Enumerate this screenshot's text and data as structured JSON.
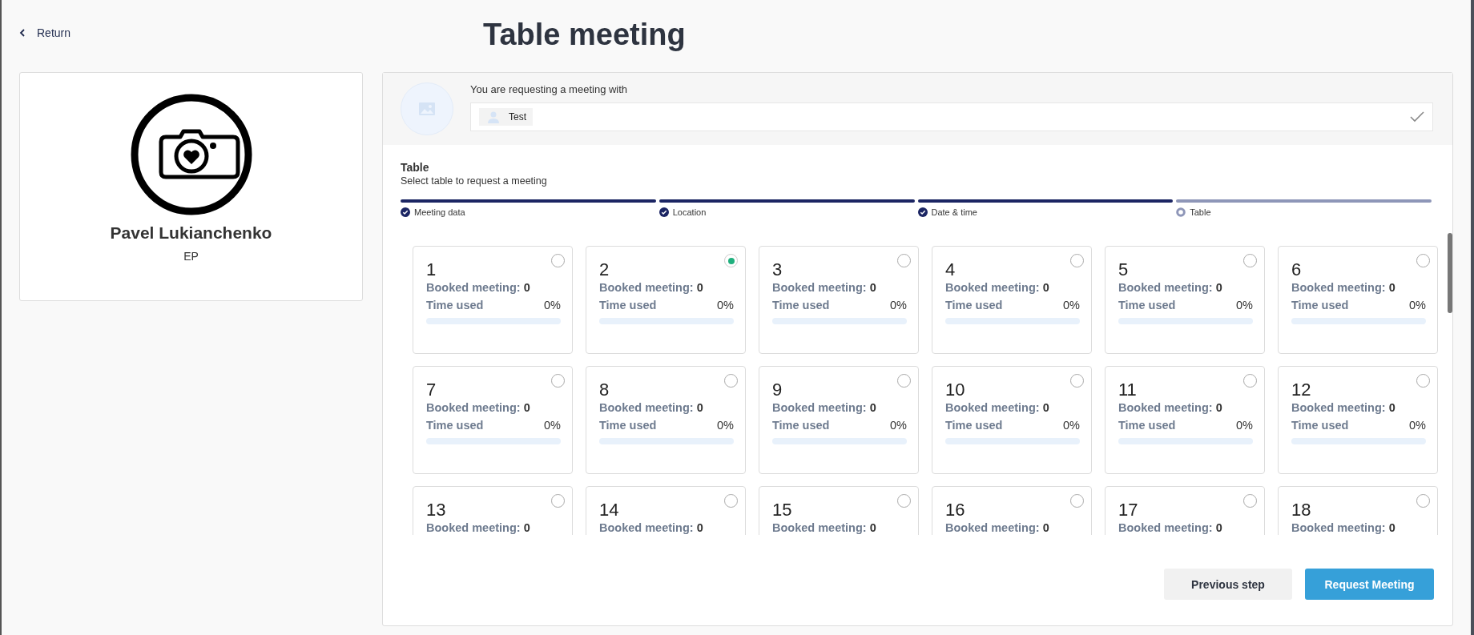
{
  "back_link": {
    "label": "Return"
  },
  "title": "Table meeting",
  "profile": {
    "name": "Pavel Lukianchenko",
    "role": "EP"
  },
  "request": {
    "label": "You are requesting a meeting with",
    "attendee": "Test"
  },
  "section": {
    "title": "Table",
    "subtitle": "Select table to request a meeting"
  },
  "steps": [
    {
      "label": "Meeting data",
      "done": true
    },
    {
      "label": "Location",
      "done": true
    },
    {
      "label": "Date & time",
      "done": true
    },
    {
      "label": "Table",
      "done": false
    }
  ],
  "tables": [
    {
      "number": "1",
      "booked": "Booked meeting: **0**",
      "time_label": "Time used",
      "time_value": "0%",
      "level": 0,
      "selected": false
    },
    {
      "number": "2",
      "booked": "Booked meeting: **0**",
      "time_label": "Time used",
      "time_value": "0%",
      "level": 0,
      "selected": true
    },
    {
      "number": "3",
      "booked": "Booked meeting: **0**",
      "time_label": "Time used",
      "time_value": "0%",
      "level": 0,
      "selected": false
    },
    {
      "number": "4",
      "booked": "Booked meeting: **0**",
      "time_label": "Time used",
      "time_value": "0%",
      "level": 0,
      "selected": false
    },
    {
      "number": "5",
      "booked": "Booked meeting: **0**",
      "time_label": "Time used",
      "time_value": "0%",
      "level": 0,
      "selected": false
    },
    {
      "number": "6",
      "booked": "Booked meeting: **0**",
      "time_label": "Time used",
      "time_value": "0%",
      "level": 0,
      "selected": false
    },
    {
      "number": "7",
      "booked": "Booked meeting: **0**",
      "time_label": "Time used",
      "time_value": "0%",
      "level": 0,
      "selected": false
    },
    {
      "number": "8",
      "booked": "Booked meeting: **0**",
      "time_label": "Time used",
      "time_value": "0%",
      "level": 0,
      "selected": false
    },
    {
      "number": "9",
      "booked": "Booked meeting: **0**",
      "time_label": "Time used",
      "time_value": "0%",
      "level": 0,
      "selected": false
    },
    {
      "number": "10",
      "booked": "Booked meeting: **0**",
      "time_label": "Time used",
      "time_value": "0%",
      "level": 0,
      "selected": false
    },
    {
      "number": "11",
      "booked": "Booked meeting: **0**",
      "time_label": "Time used",
      "time_value": "0%",
      "level": 0,
      "selected": false
    },
    {
      "number": "12",
      "booked": "Booked meeting: **0**",
      "time_label": "Time used",
      "time_value": "0%",
      "level": 0,
      "selected": false
    },
    {
      "number": "13",
      "booked": "Booked meeting: **0**",
      "selected": false
    },
    {
      "number": "14",
      "booked": "Booked meeting: **0**",
      "selected": false
    },
    {
      "number": "15",
      "booked": "Booked meeting: **0**",
      "selected": false
    },
    {
      "number": "16",
      "booked": "Booked meeting: **0**",
      "selected": false
    },
    {
      "number": "17",
      "booked": "Booked meeting: **0**",
      "selected": false
    },
    {
      "number": "18",
      "booked": "Booked meeting: **0**",
      "selected": false
    }
  ],
  "buttons": {
    "previous": "Previous step",
    "submit": "Request Meeting"
  }
}
